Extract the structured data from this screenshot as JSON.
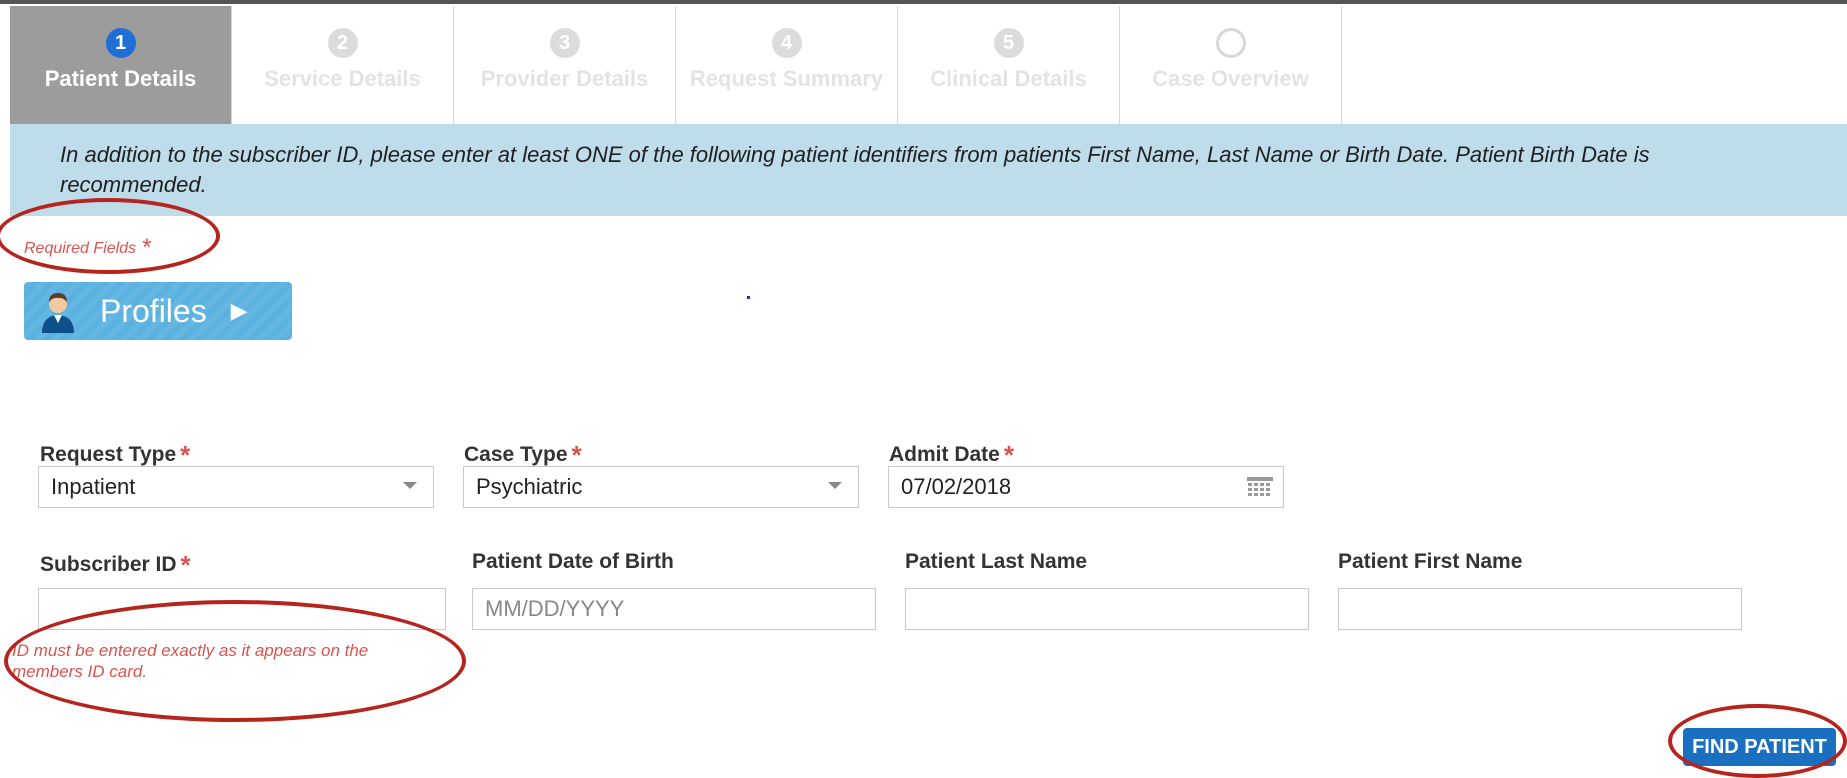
{
  "steps": [
    {
      "num": "1",
      "label": "Patient Details",
      "active": true
    },
    {
      "num": "2",
      "label": "Service Details"
    },
    {
      "num": "3",
      "label": "Provider Details"
    },
    {
      "num": "4",
      "label": "Request Summary"
    },
    {
      "num": "5",
      "label": "Clinical Details"
    },
    {
      "num": "",
      "label": "Case Overview"
    }
  ],
  "banner": {
    "text": "In addition to the subscriber ID, please enter at least ONE of the following patient identifiers from patients First Name, Last Name or Birth Date. Patient Birth Date is recommended."
  },
  "required_fields": {
    "label": "Required Fields",
    "asterisk": "*"
  },
  "profiles_button": {
    "label": "Profiles",
    "icon": "user-icon",
    "chevron": "chevron-right-icon"
  },
  "form": {
    "request_type": {
      "label": "Request Type",
      "value": "Inpatient",
      "required": "*"
    },
    "case_type": {
      "label": "Case Type",
      "value": "Psychiatric",
      "required": "*"
    },
    "admit_date": {
      "label": "Admit Date",
      "value": "07/02/2018",
      "required": "*",
      "icon": "calendar-icon"
    },
    "subscriber_id": {
      "label": "Subscriber ID",
      "value": "",
      "required": "*",
      "hint": "ID must be entered exactly as it appears on the members ID card."
    },
    "patient_dob": {
      "label": "Patient Date of Birth",
      "placeholder": "MM/DD/YYYY"
    },
    "patient_last_name": {
      "label": "Patient Last Name",
      "value": ""
    },
    "patient_first_name": {
      "label": "Patient First Name",
      "value": ""
    }
  },
  "find_patient_button": {
    "label": "FIND PATIENT"
  },
  "colors": {
    "active_step": "#9c9c9c",
    "step_badge": "#1e6fd6",
    "banner": "#bfdceb",
    "required": "#d9534f",
    "annotation": "#b5241d",
    "primary_button": "#1a6fc0",
    "profiles": "#5bb2e0"
  }
}
